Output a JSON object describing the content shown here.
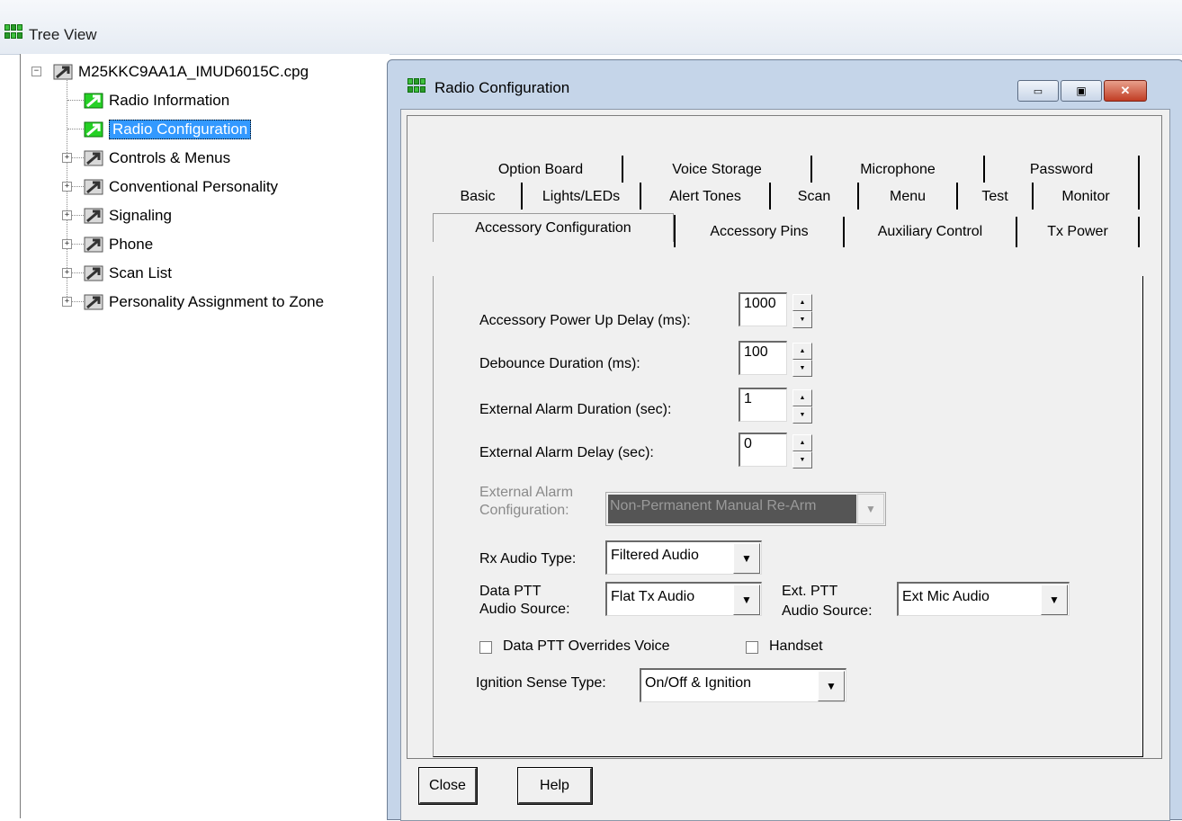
{
  "tree_view": {
    "title": "Tree View",
    "root": "M25KKC9AA1A_IMUD6015C.cpg",
    "items": [
      {
        "label": "Radio Information",
        "expandable": false,
        "selected": false
      },
      {
        "label": "Radio Configuration",
        "expandable": false,
        "selected": true
      },
      {
        "label": "Controls & Menus",
        "expandable": true,
        "selected": false
      },
      {
        "label": "Conventional Personality",
        "expandable": true,
        "selected": false
      },
      {
        "label": "Signaling",
        "expandable": true,
        "selected": false
      },
      {
        "label": "Phone",
        "expandable": true,
        "selected": false
      },
      {
        "label": "Scan List",
        "expandable": true,
        "selected": false
      },
      {
        "label": "Personality Assignment to Zone",
        "expandable": true,
        "selected": false
      }
    ],
    "expander_collapsed": "+",
    "expander_expanded": "−"
  },
  "window": {
    "title": "Radio Configuration",
    "min_glyph": "▭",
    "restore_glyph": "▣",
    "close_glyph": "✕"
  },
  "tabs": {
    "row1": [
      "Option Board",
      "Voice Storage",
      "Microphone",
      "Password"
    ],
    "row2": [
      "Basic",
      "Lights/LEDs",
      "Alert Tones",
      "Scan",
      "Menu",
      "Test",
      "Monitor"
    ],
    "row3": [
      "Accessory Configuration",
      "Accessory Pins",
      "Auxiliary Control",
      "Tx Power"
    ],
    "active": "Accessory Configuration"
  },
  "form": {
    "power_up_delay": {
      "label": "Accessory Power Up Delay (ms):",
      "value": "1000"
    },
    "debounce": {
      "label": "Debounce Duration (ms):",
      "value": "100"
    },
    "alarm_duration": {
      "label": "External Alarm Duration (sec):",
      "value": "1"
    },
    "alarm_delay": {
      "label": "External Alarm Delay (sec):",
      "value": "0"
    },
    "alarm_config": {
      "label_line1": "External Alarm",
      "label_line2": "Configuration:",
      "value": "Non-Permanent Manual Re-Arm",
      "disabled": true
    },
    "rx_audio": {
      "label": "Rx Audio Type:",
      "value": "Filtered Audio"
    },
    "data_ptt_source": {
      "label_line1": "Data PTT",
      "label_line2": "Audio Source:",
      "value": "Flat Tx Audio"
    },
    "ext_ptt_source": {
      "label_line1": "Ext. PTT",
      "label_line2": "Audio Source:",
      "value": "Ext Mic Audio"
    },
    "data_ptt_overrides": {
      "label": "Data PTT Overrides Voice",
      "checked": false
    },
    "handset": {
      "label": "Handset",
      "checked": false
    },
    "ignition_sense": {
      "label": "Ignition Sense Type:",
      "value": "On/Off & Ignition"
    }
  },
  "buttons": {
    "close": "Close",
    "help": "Help"
  },
  "glyphs": {
    "spin_up": "▲",
    "spin_down": "▼",
    "dropdown": "▼"
  }
}
